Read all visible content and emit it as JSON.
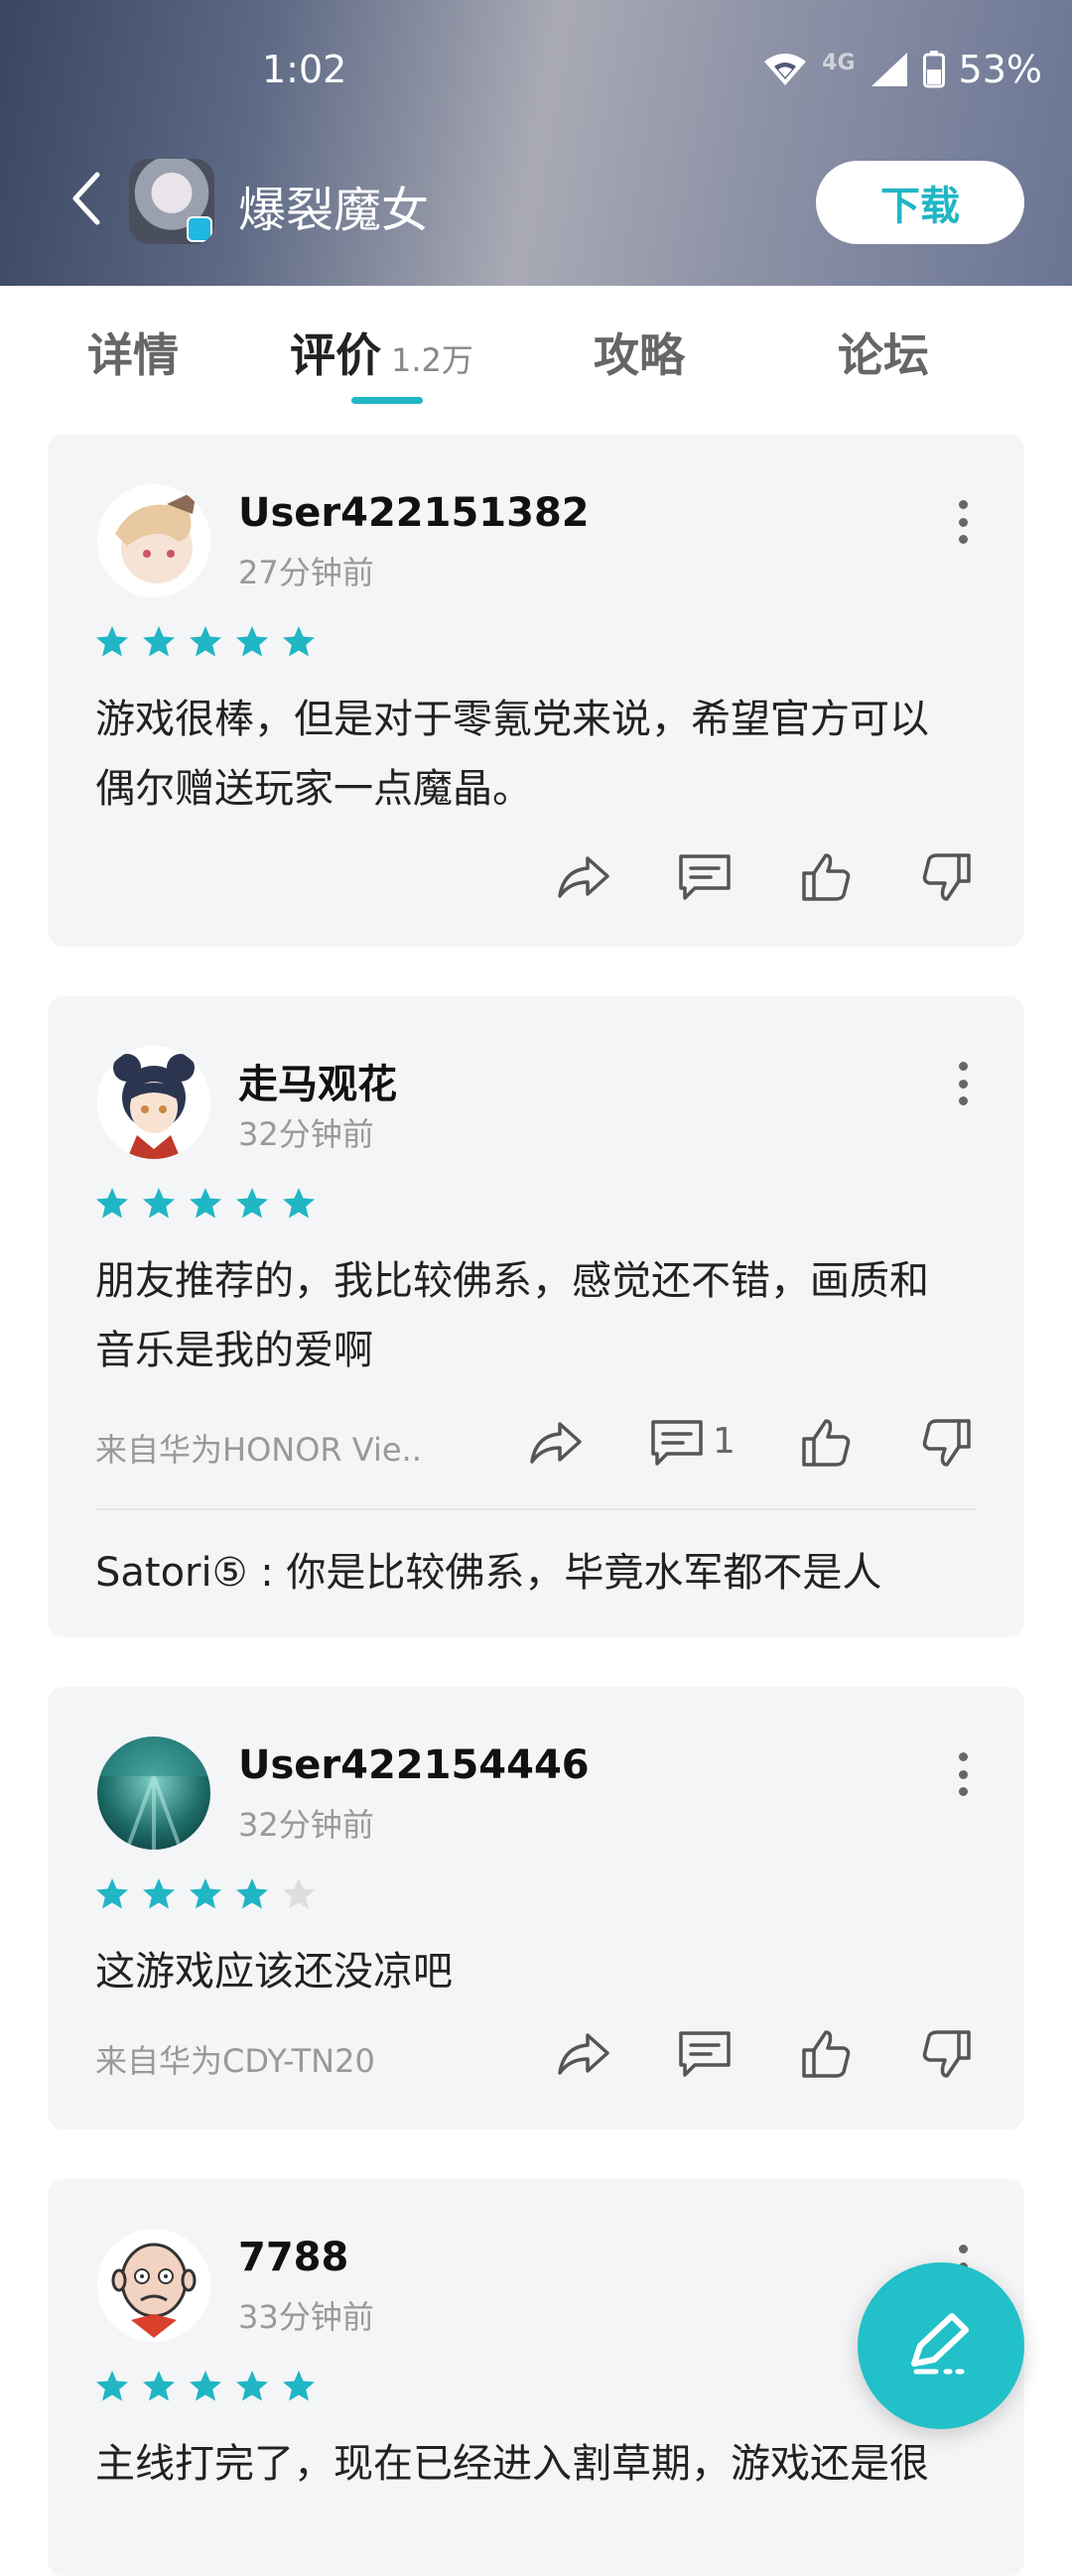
{
  "status_bar": {
    "time": "1:02",
    "network": "4G",
    "battery": "53%"
  },
  "header": {
    "app_title": "爆裂魔女",
    "download_label": "下载"
  },
  "tabs": [
    {
      "label": "详情"
    },
    {
      "label": "评价",
      "count": "1.2万"
    },
    {
      "label": "攻略"
    },
    {
      "label": "论坛"
    }
  ],
  "colors": {
    "accent": "#20b6c4",
    "star_filled": "#20b6c4",
    "star_empty": "#dddddd"
  },
  "reviews": [
    {
      "username": "User422151382",
      "time": "27分钟前",
      "rating": 5,
      "text_line1": "游戏很棒，但是对于零氪党来说，希望官方可以",
      "text_line2": "偶尔赠送玩家一点魔晶。",
      "device": "",
      "reply_count": "",
      "reply": ""
    },
    {
      "username": "走马观花",
      "time": "32分钟前",
      "rating": 5,
      "text_line1": "朋友推荐的，我比较佛系，感觉还不错，画质和",
      "text_line2": "音乐是我的爱啊",
      "device": "来自华为HONOR Vie...",
      "reply_count": "1",
      "reply": "Satori⑤ : 你是比较佛系，毕竟水军都不是人"
    },
    {
      "username": "User422154446",
      "time": "32分钟前",
      "rating": 4,
      "text_line1": "这游戏应该还没凉吧",
      "device": "来自华为CDY-TN20",
      "reply_count": ""
    },
    {
      "username": "7788",
      "time": "33分钟前",
      "rating": 5,
      "text_line1": "主线打完了，现在已经进入割草期，游戏还是很"
    }
  ]
}
